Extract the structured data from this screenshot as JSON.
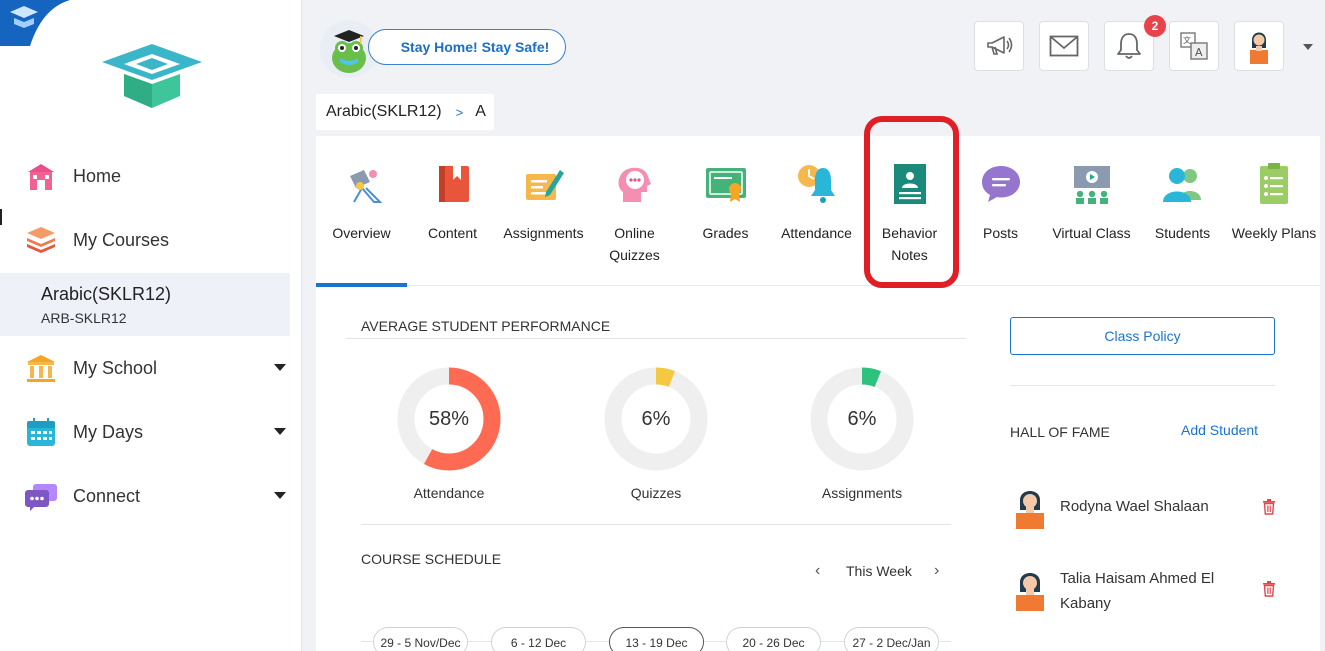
{
  "sidebar": {
    "nav": [
      {
        "label": "Home",
        "icon": "school-building-icon"
      },
      {
        "label": "My Courses",
        "icon": "books-stack-icon"
      },
      {
        "label": "My School",
        "icon": "institution-icon"
      },
      {
        "label": "My Days",
        "icon": "calendar-icon"
      },
      {
        "label": "Connect",
        "icon": "chat-bubbles-icon"
      }
    ],
    "active_course": {
      "name": "Arabic(SKLR12)",
      "code": "ARB-SKLR12"
    }
  },
  "header": {
    "banner": "Stay Home! Stay Safe!",
    "notification_count": "2",
    "buttons": [
      "megaphone-icon",
      "mail-icon",
      "bell-icon",
      "translate-icon",
      "profile-avatar"
    ]
  },
  "breadcrumb": {
    "course": "Arabic(SKLR12)",
    "separator": ">",
    "section": "A"
  },
  "tabs": [
    {
      "label": "Overview",
      "icon": "overview-icon",
      "active": true
    },
    {
      "label": "Content",
      "icon": "book-icon"
    },
    {
      "label": "Assignments",
      "icon": "assignment-icon"
    },
    {
      "label": "Online Quizzes",
      "icon": "quiz-icon"
    },
    {
      "label": "Grades",
      "icon": "certificate-icon"
    },
    {
      "label": "Attendance",
      "icon": "attendance-bell-icon"
    },
    {
      "label": "Behavior Notes",
      "icon": "behavior-notes-icon"
    },
    {
      "label": "Posts",
      "icon": "chat-icon"
    },
    {
      "label": "Virtual Class",
      "icon": "virtual-class-icon"
    },
    {
      "label": "Students",
      "icon": "students-icon"
    },
    {
      "label": "Weekly Plans",
      "icon": "checklist-icon"
    }
  ],
  "performance": {
    "title": "AVERAGE STUDENT PERFORMANCE",
    "items": [
      {
        "label": "Attendance",
        "value": "58%",
        "fraction": 0.58
      },
      {
        "label": "Quizzes",
        "value": "6%",
        "fraction": 0.06
      },
      {
        "label": "Assignments",
        "value": "6%",
        "fraction": 0.06
      }
    ]
  },
  "schedule": {
    "title": "COURSE SCHEDULE",
    "week_label": "This Week",
    "weeks": [
      "29 - 5 Nov/Dec",
      "6 - 12 Dec",
      "13 - 19 Dec",
      "20 - 26 Dec",
      "27 - 2 Dec/Jan"
    ],
    "selected_week": 2
  },
  "right_panel": {
    "class_policy": "Class Policy",
    "hall_of_fame_title": "HALL OF FAME",
    "add_student": "Add Student",
    "students": [
      {
        "name_line1": "Rodyna Wael Shalaan",
        "name_line2": ""
      },
      {
        "name_line1": "Talia Haisam Ahmed El",
        "name_line2": "Kabany"
      }
    ]
  },
  "colors": {
    "accent": "#1a73d1",
    "highlight": "#e01e26",
    "badge": "#e8434b",
    "attendance_ring": "#ff6b52",
    "quizzes_ring": "#f5c842",
    "assignments_ring": "#2ec27e"
  }
}
